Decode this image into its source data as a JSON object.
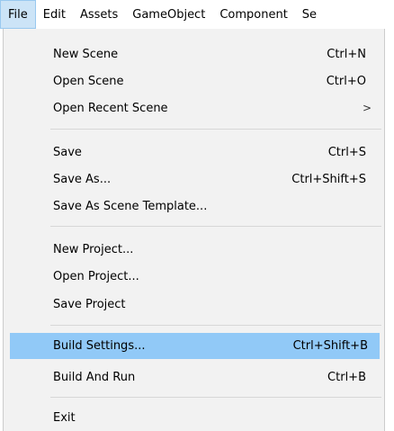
{
  "menubar": {
    "items": [
      {
        "label": "File"
      },
      {
        "label": "Edit"
      },
      {
        "label": "Assets"
      },
      {
        "label": "GameObject"
      },
      {
        "label": "Component"
      },
      {
        "label": "Se"
      }
    ]
  },
  "file_menu": {
    "items": [
      {
        "label": "New Scene",
        "shortcut": "Ctrl+N"
      },
      {
        "label": "Open Scene",
        "shortcut": "Ctrl+O"
      },
      {
        "label": "Open Recent Scene",
        "submenu_arrow": ">"
      },
      {
        "label": "Save",
        "shortcut": "Ctrl+S"
      },
      {
        "label": "Save As...",
        "shortcut": "Ctrl+Shift+S"
      },
      {
        "label": "Save As Scene Template..."
      },
      {
        "label": "New Project..."
      },
      {
        "label": "Open Project..."
      },
      {
        "label": "Save Project"
      },
      {
        "label": "Build Settings...",
        "shortcut": "Ctrl+Shift+B",
        "highlighted": true
      },
      {
        "label": "Build And Run",
        "shortcut": "Ctrl+B"
      },
      {
        "label": "Exit"
      }
    ]
  },
  "colors": {
    "highlight": "#91c9f7",
    "menu_background": "#f2f2f2",
    "active_menubar": "#cce4f7"
  }
}
